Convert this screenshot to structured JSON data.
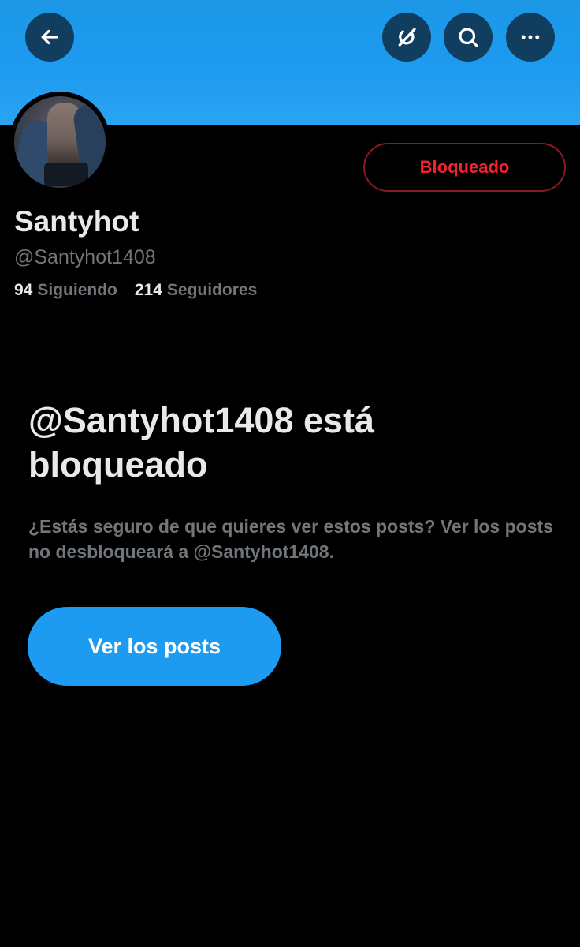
{
  "header": {
    "back_icon": "arrow-left-icon",
    "grok_icon": "grok-icon",
    "search_icon": "search-icon",
    "more_icon": "more-horizontal-icon",
    "banner_color": "#1d9bf0"
  },
  "profile": {
    "display_name": "Santyhot",
    "handle": "@Santyhot1408",
    "following_count": "94",
    "following_label": "Siguiendo",
    "followers_count": "214",
    "followers_label": "Seguidores",
    "blocked_button_label": "Bloqueado",
    "blocked_color": "#f4212e"
  },
  "blocked_notice": {
    "title": "@Santyhot1408 está bloqueado",
    "description": "¿Estás seguro de que quieres ver estos posts? Ver los posts no desbloqueará a @Santyhot1408.",
    "view_button_label": "Ver los posts"
  }
}
